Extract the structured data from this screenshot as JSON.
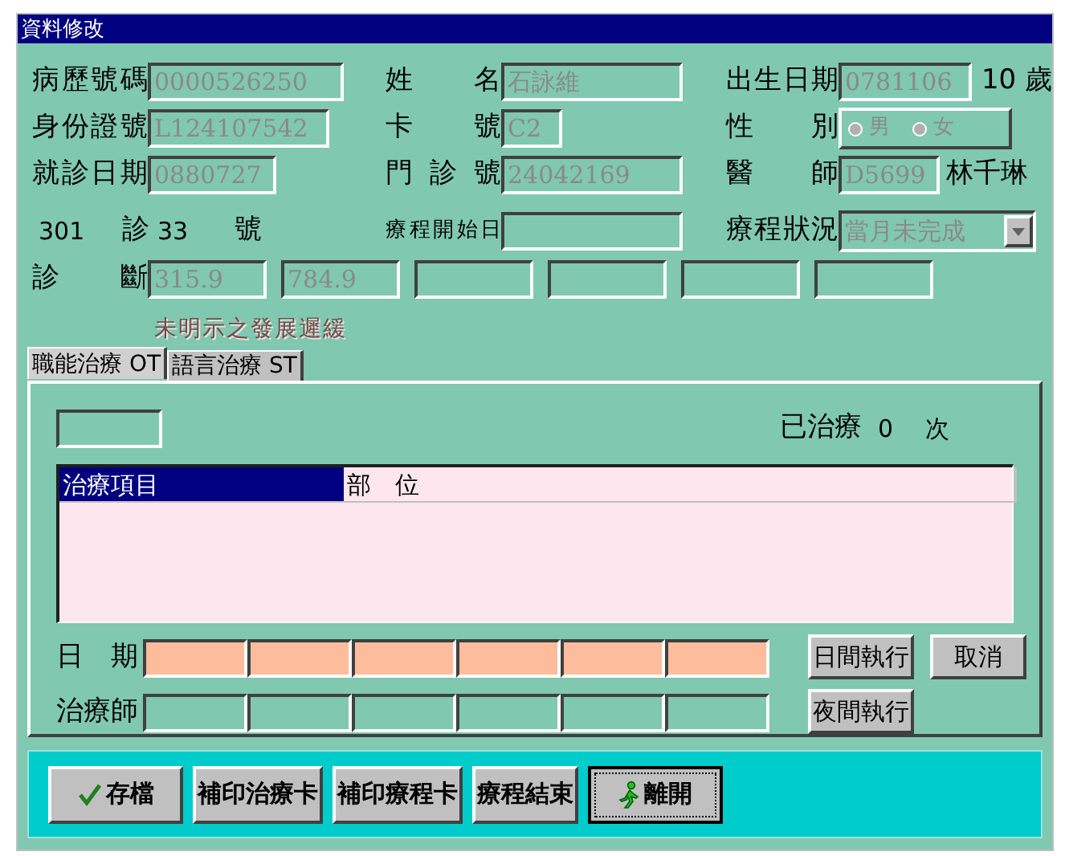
{
  "window": {
    "title": "資料修改"
  },
  "row1": [
    {
      "label": "病歷號碼",
      "value": "0000526250"
    },
    {
      "label": "姓　名",
      "value": "石詠維"
    },
    {
      "label": "出生日期",
      "value": "0781106"
    }
  ],
  "age": "10 歲",
  "row2": [
    {
      "label": "身份證號",
      "value": "L124107542"
    },
    {
      "label": "卡　號",
      "value": "C2"
    },
    {
      "label": "性　別"
    }
  ],
  "sex_options": [
    {
      "label": "男",
      "selected": false
    },
    {
      "label": "女",
      "selected": false
    }
  ],
  "row3": [
    {
      "label": "就診日期",
      "value": "0880727"
    },
    {
      "label": "門 診 號",
      "value": "24042169"
    },
    {
      "label": "醫　師",
      "value": "D5699"
    }
  ],
  "doctor_name": "林千琳",
  "clinic": [
    "301",
    "診",
    "33",
    "號"
  ],
  "course_start": {
    "label": "療程開始日"
  },
  "course_status": {
    "label": "療程狀況",
    "value": "當月未完成"
  },
  "diagnosis": {
    "label": "診　斷",
    "codes": [
      "315.9",
      "784.9"
    ],
    "description": "未明示之發展遲緩"
  },
  "tabs": [
    {
      "label": "職能治療 OT",
      "selected": true
    },
    {
      "label": "語言治療 ST",
      "selected": false
    }
  ],
  "treated": [
    "已治療",
    "0",
    "次"
  ],
  "list_columns": [
    {
      "label": "治療項目",
      "selected": true
    },
    {
      "label": "部　位",
      "selected": false
    }
  ],
  "date_label": "日　期",
  "therapist_label": "治療師",
  "side_buttons": [
    "日間執行",
    "取消",
    "夜間執行"
  ],
  "footer_buttons": [
    {
      "label": "存檔",
      "kind": "check",
      "focused": false
    },
    {
      "label": "補印治療卡",
      "kind": "plain",
      "focused": false
    },
    {
      "label": "補印療程卡",
      "kind": "plain",
      "focused": false
    },
    {
      "label": "療程結束",
      "kind": "plain",
      "focused": false
    },
    {
      "label": "離開",
      "kind": "exit",
      "focused": true
    }
  ]
}
